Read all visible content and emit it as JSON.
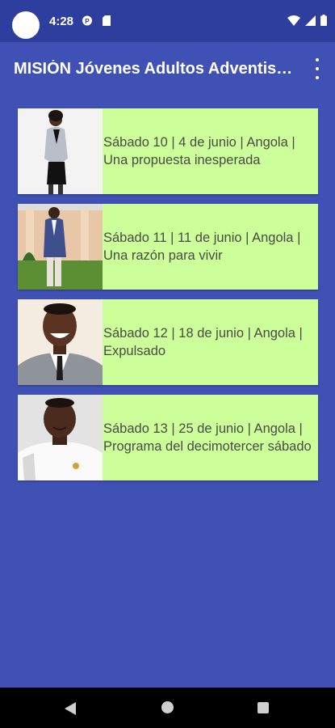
{
  "status_bar": {
    "time": "4:28",
    "icons": [
      "wifi-icon",
      "signal-icon",
      "battery-icon"
    ]
  },
  "app_bar": {
    "title": "MISIÓN Jóvenes Adultos Adventistas",
    "menu_icon": "more-vert-icon"
  },
  "colors": {
    "primary": "#3f51b5",
    "primary_dark": "#2d3e9f",
    "card_background": "#ccff99",
    "card_text": "#4a4a4a"
  },
  "items": [
    {
      "text": "Sábado 10 | 4 de junio | Angola | Una propuesta inesperada",
      "image": "woman-grey-blazer-portrait"
    },
    {
      "text": "Sábado 11 | 11 de junio | Angola | Una razón para vivir",
      "image": "man-blue-suit-garden-portrait"
    },
    {
      "text": "Sábado 12 | 18 de junio | Angola | Expulsado",
      "image": "smiling-man-suit-tie-portrait"
    },
    {
      "text": "Sábado 13 | 25 de junio | Angola | Programa del decimotercer sábado",
      "image": "man-white-jersey-portrait"
    }
  ],
  "nav_bar": {
    "back_icon": "back-icon",
    "home_icon": "home-icon",
    "recents_icon": "recents-icon"
  }
}
